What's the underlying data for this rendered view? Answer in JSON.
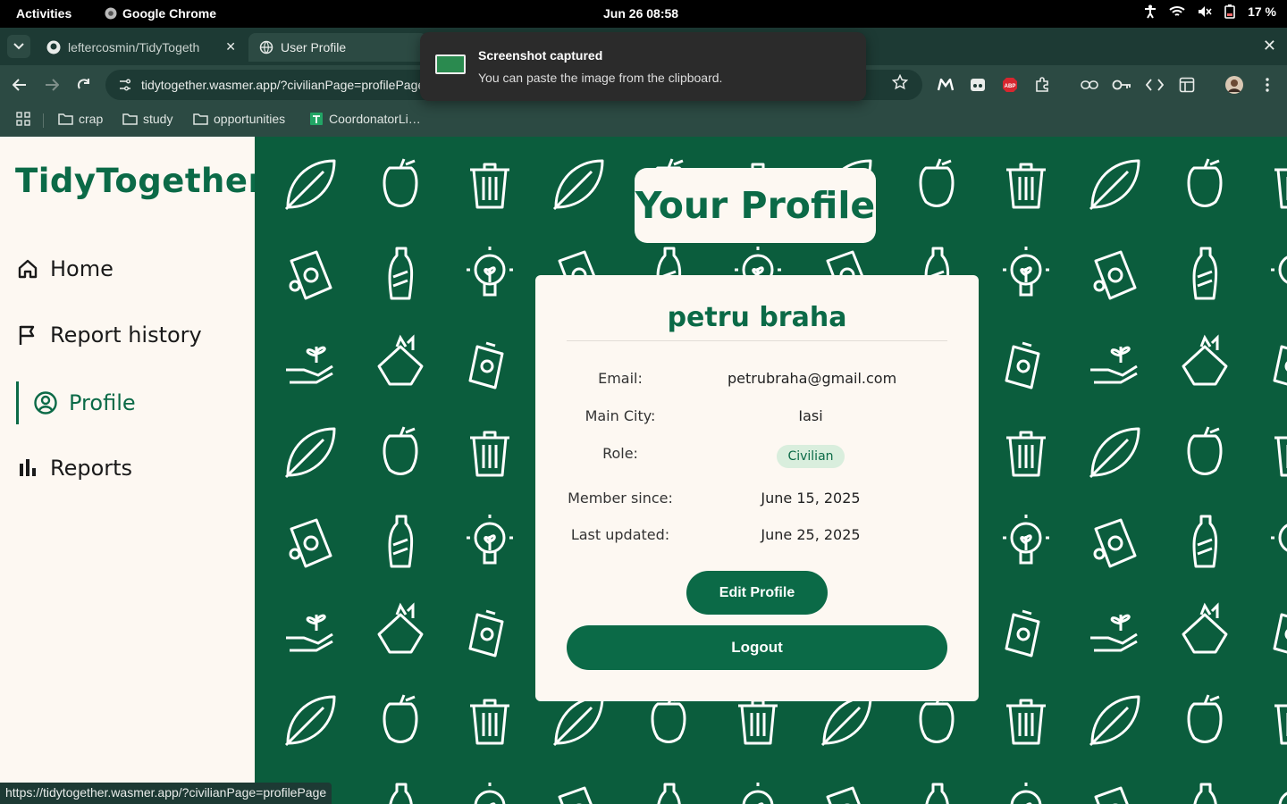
{
  "system_bar": {
    "activities": "Activities",
    "app_name": "Google Chrome",
    "clock": "Jun 26  08:58",
    "battery": "17 %"
  },
  "browser": {
    "tabs": [
      {
        "label": "leftercosmin/TidyTogeth"
      },
      {
        "label": "User Profile"
      }
    ],
    "url": "tidytogether.wasmer.app/?civilianPage=profilePage",
    "bookmarks": [
      {
        "label": "crap"
      },
      {
        "label": "study"
      },
      {
        "label": "opportunities"
      },
      {
        "label": "CoordonatorLi…"
      }
    ],
    "status_url": "https://tidytogether.wasmer.app/?civilianPage=profilePage"
  },
  "notification": {
    "title": "Screenshot captured",
    "body": "You can paste the image from the clipboard."
  },
  "sidebar": {
    "logo": "TidyTogether",
    "items": [
      {
        "label": "Home",
        "icon": "home-icon"
      },
      {
        "label": "Report history",
        "icon": "flag-icon"
      },
      {
        "label": "Profile",
        "icon": "user-circle-icon",
        "active": true
      },
      {
        "label": "Reports",
        "icon": "bar-chart-icon"
      }
    ]
  },
  "profile": {
    "page_title": "Your Profile",
    "name": "petru braha",
    "fields": {
      "email_label": "Email:",
      "email": "petrubraha@gmail.com",
      "city_label": "Main City:",
      "city": "Iasi",
      "role_label": "Role:",
      "role": "Civilian",
      "member_label": "Member since:",
      "member_since": "June 15, 2025",
      "updated_label": "Last updated:",
      "last_updated": "June 25, 2025"
    },
    "edit_label": "Edit Profile",
    "logout_label": "Logout"
  },
  "colors": {
    "brand_green": "#0b6a47",
    "background_green": "#0b5d3d",
    "cream": "#fdf8f2"
  }
}
